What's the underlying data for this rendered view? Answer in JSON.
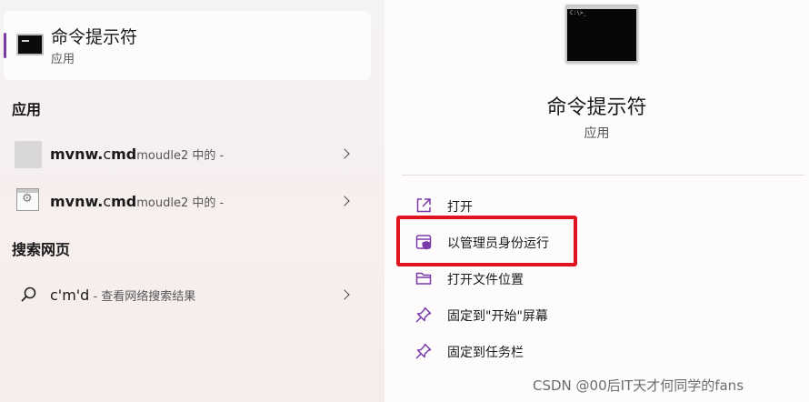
{
  "best_match": {
    "title": "命令提示符",
    "subtitle": "应用",
    "icon": "command-prompt-icon"
  },
  "sections": {
    "apps_title": "应用",
    "web_title": "搜索网页"
  },
  "apps": [
    {
      "name_prefix": "mvnw.",
      "name_match": "c",
      "name_rest": "md",
      "location": "moudle2 中的 -",
      "icon": "blank-file-icon"
    },
    {
      "name_prefix": "mvnw.",
      "name_match": "c",
      "name_rest": "md",
      "location": "moudle2 中的 -",
      "icon": "batch-file-icon"
    }
  ],
  "web_search": {
    "query": "c'm'd",
    "hint": " - 查看网络搜索结果",
    "icon": "search-icon"
  },
  "detail": {
    "title": "命令提示符",
    "subtitle": "应用",
    "console_text": "C:\\>_"
  },
  "actions": [
    {
      "label": "打开",
      "icon": "open-icon"
    },
    {
      "label": "以管理员身份运行",
      "icon": "admin-shield-icon"
    },
    {
      "label": "打开文件位置",
      "icon": "folder-icon"
    },
    {
      "label": "固定到\"开始\"屏幕",
      "icon": "pin-icon"
    },
    {
      "label": "固定到任务栏",
      "icon": "pin-icon"
    }
  ],
  "watermark": "CSDN @00后IT天才何同学的fans",
  "colors": {
    "accent": "#7a3aa8",
    "highlight_box": "#e0141e"
  }
}
